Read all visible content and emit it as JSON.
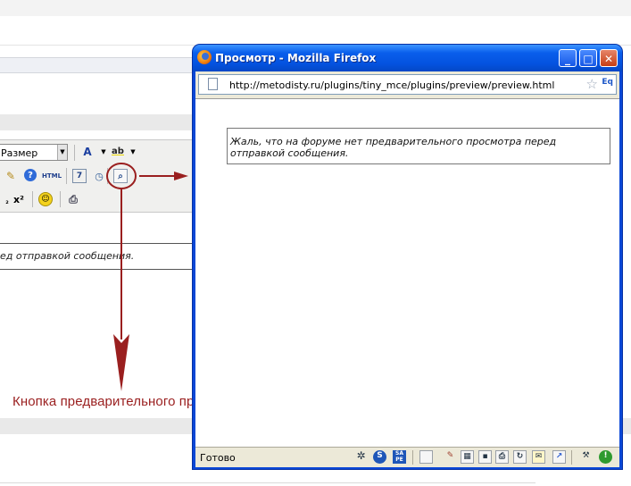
{
  "editor": {
    "font_size_select": "Размер",
    "content_text": "ед отправкой сообщения."
  },
  "callout": {
    "label": "Кнопка предварительного просмотра",
    "color": "#9a1f1f"
  },
  "preview_window": {
    "title": "Просмотр - Mozilla Firefox",
    "url": "http://metodisty.ru/plugins/tiny_mce/plugins/preview/preview.html",
    "feed_indicator": "Eq",
    "preview_text": "Жаль, что на форуме нет предварительного просмотра перед отправкой сообщения.",
    "status": "Готово",
    "buttons": {
      "minimize": "_",
      "maximize": "□",
      "close": "✕"
    },
    "title_color": "#0a47d6"
  },
  "icons": [
    "firefox-icon",
    "document-icon",
    "bookmark-star-icon",
    "feed-icon",
    "font-color-icon",
    "highlight-color-icon",
    "cleanup-brush-icon",
    "help-icon",
    "html-source-icon",
    "insert-date-icon",
    "insert-time-icon",
    "preview-icon",
    "subscript-icon",
    "superscript-icon",
    "emoticon-icon",
    "print-icon"
  ]
}
